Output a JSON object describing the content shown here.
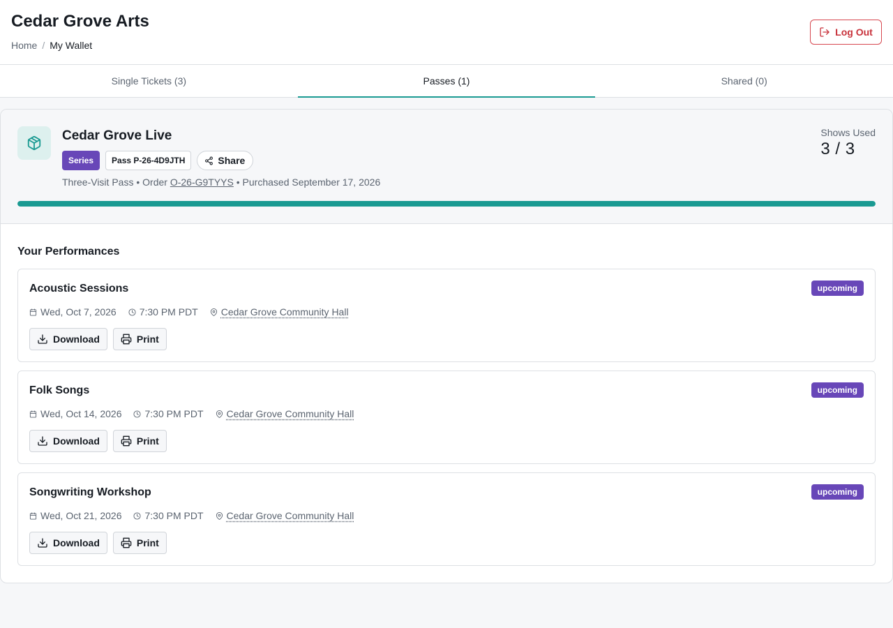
{
  "header": {
    "brand": "Cedar Grove Arts",
    "breadcrumb": {
      "home": "Home",
      "separator": "/",
      "current": "My Wallet"
    },
    "logout_label": "Log Out"
  },
  "tabs": [
    {
      "label": "Single Tickets (3)",
      "active": false
    },
    {
      "label": "Passes (1)",
      "active": true
    },
    {
      "label": "Shared (0)",
      "active": false
    }
  ],
  "pass": {
    "icon": "package-icon",
    "title": "Cedar Grove Live",
    "series_badge": "Series",
    "pass_badge": "Pass P-26-4D9JTH",
    "share_label": "Share",
    "type": "Three-Visit Pass",
    "bullet": "•",
    "order_prefix": "Order",
    "order_id": "O-26-G9TYYS",
    "purchased": "Purchased September 17, 2026",
    "shows_used_label": "Shows Used",
    "shows_used_value": "3 / 3",
    "progress_fraction": 1.0
  },
  "performances": {
    "heading": "Your Performances",
    "items": [
      {
        "title": "Acoustic Sessions",
        "status": "upcoming",
        "date": "Wed, Oct 7, 2026",
        "time": "7:30 PM PDT",
        "venue": "Cedar Grove Community Hall",
        "download_label": "Download",
        "print_label": "Print"
      },
      {
        "title": "Folk Songs",
        "status": "upcoming",
        "date": "Wed, Oct 14, 2026",
        "time": "7:30 PM PDT",
        "venue": "Cedar Grove Community Hall",
        "download_label": "Download",
        "print_label": "Print"
      },
      {
        "title": "Songwriting Workshop",
        "status": "upcoming",
        "date": "Wed, Oct 21, 2026",
        "time": "7:30 PM PDT",
        "venue": "Cedar Grove Community Hall",
        "download_label": "Download",
        "print_label": "Print"
      }
    ]
  },
  "colors": {
    "accent": "#1a9a92",
    "series_badge": "#6847b8",
    "logout": "#c8323b"
  }
}
